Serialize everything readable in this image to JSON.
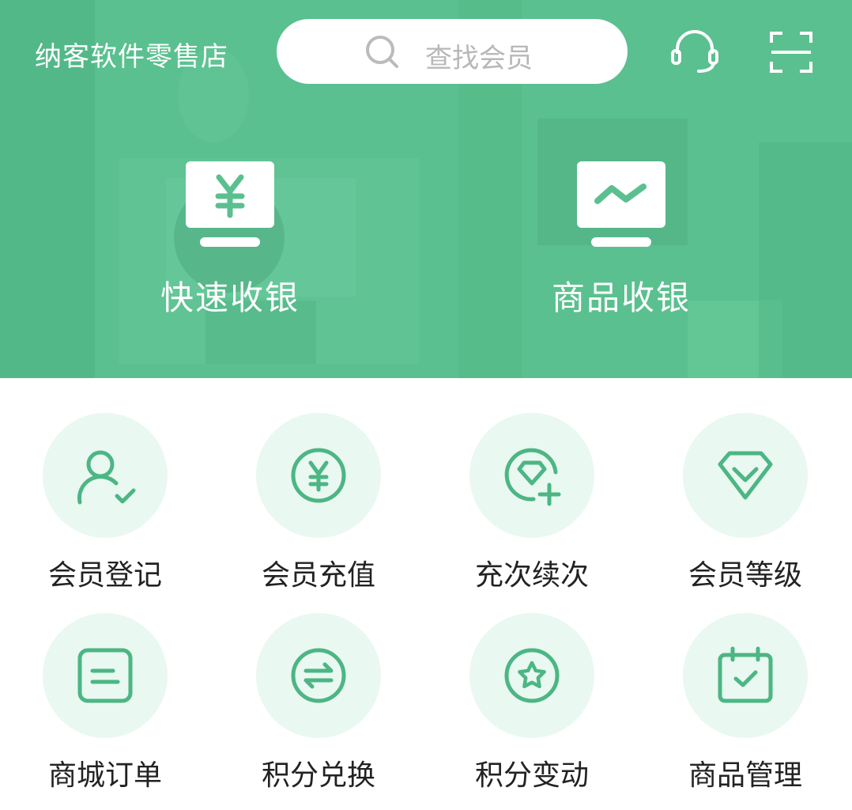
{
  "header": {
    "store_name": "纳客软件零售店",
    "search_placeholder": "查找会员",
    "icons": [
      "search-icon",
      "headset-icon",
      "scan-icon"
    ]
  },
  "hero": {
    "buttons": [
      {
        "label": "快速收银",
        "icon": "yen-monitor-icon"
      },
      {
        "label": "商品收银",
        "icon": "chart-monitor-icon"
      }
    ]
  },
  "menu": {
    "items": [
      {
        "label": "会员登记",
        "icon": "user-check-icon"
      },
      {
        "label": "会员充值",
        "icon": "yen-circle-icon"
      },
      {
        "label": "充次续次",
        "icon": "diamond-plus-icon"
      },
      {
        "label": "会员等级",
        "icon": "diamond-icon"
      },
      {
        "label": "商城订单",
        "icon": "order-list-icon"
      },
      {
        "label": "积分兑换",
        "icon": "exchange-icon"
      },
      {
        "label": "积分变动",
        "icon": "star-circle-icon"
      },
      {
        "label": "商品管理",
        "icon": "calendar-check-icon"
      }
    ]
  },
  "colors": {
    "accent": "#5ac08f",
    "icon_stroke": "#4cb684",
    "icon_bg": "#e9f8f1",
    "label_text": "#222222",
    "placeholder_text": "#b8b8b8"
  }
}
